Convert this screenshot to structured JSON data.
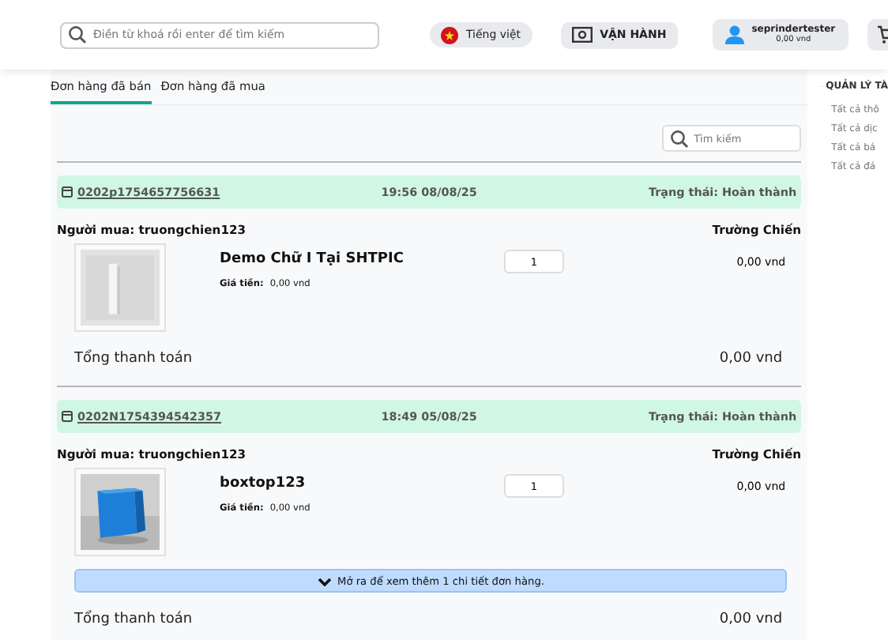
{
  "header": {
    "search": {
      "placeholder": "Điền từ khoá rồi enter để tìm kiếm"
    },
    "language": "Tiếng việt",
    "operate": "VẬN HÀNH",
    "user": {
      "name": "seprindertester",
      "balance": "0,00 vnd"
    }
  },
  "tabs": [
    {
      "label": "Đơn hàng đã bán",
      "selected": true
    },
    {
      "label": "Đơn hàng đã mua",
      "selected": false
    }
  ],
  "order_search": {
    "placeholder": "Tìm kiếm"
  },
  "orders": [
    {
      "id": "0202p1754657756631",
      "time": "19:56 08/08/25",
      "status": "Trạng thái: Hoàn thành",
      "buyer": "Người mua: truongchien123",
      "seller": "Trường Chiến",
      "items": [
        {
          "name": "Demo Chữ I Tại SHTPIC",
          "price_label": "Giá tiền:",
          "price": "0,00 vnd",
          "qty": "1",
          "amount": "0,00 vnd"
        }
      ],
      "total_label": "Tổng thanh toán",
      "total": "0,00 vnd"
    },
    {
      "id": "0202N1754394542357",
      "time": "18:49 05/08/25",
      "status": "Trạng thái: Hoàn thành",
      "buyer": "Người mua: truongchien123",
      "seller": "Trường Chiến",
      "items": [
        {
          "name": "boxtop123",
          "price_label": "Giá tiền:",
          "price": "0,00 vnd",
          "qty": "1",
          "amount": "0,00 vnd"
        }
      ],
      "expand": "Mở ra để xem thêm 1 chi tiết đơn hàng.",
      "total_label": "Tổng thanh toán",
      "total": "0,00 vnd"
    }
  ],
  "sidebar": {
    "title": "QUẢN LÝ TÀ",
    "items": [
      "Tất cả thô",
      "Tất cả dịc",
      "Tất cả bá",
      "Tất cả đá"
    ]
  }
}
